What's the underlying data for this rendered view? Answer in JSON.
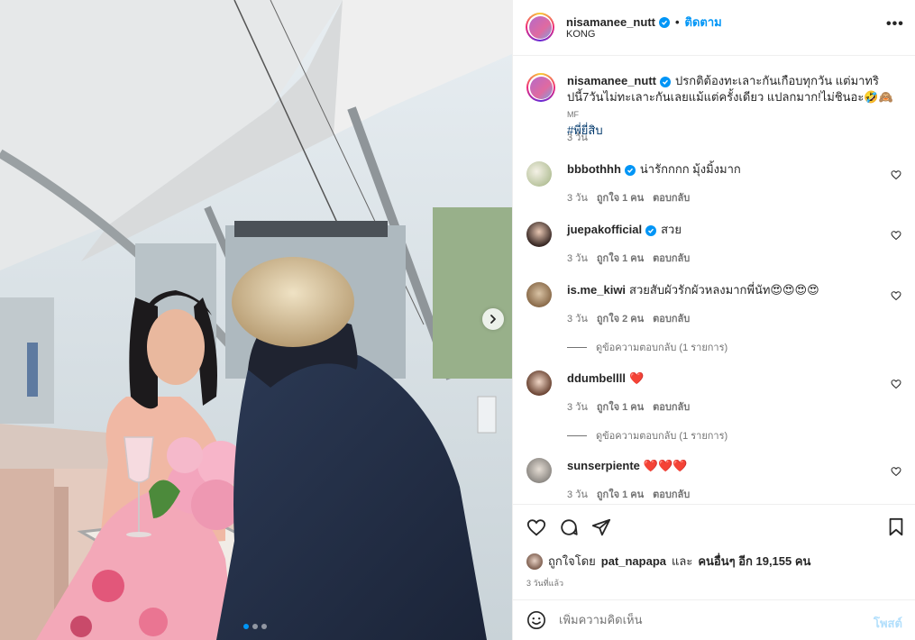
{
  "header": {
    "username": "nisamanee_nutt",
    "separator": "•",
    "follow_label": "ติดตาม",
    "location": "KONG",
    "more_label": "•••"
  },
  "caption": {
    "username": "nisamanee_nutt",
    "text": "ปรกติต้องทะเลาะกันเกือบทุกวัน แต่มาทริปนี้7วันไม่ทะเลาะกันเลยแม้แต่ครั้งเดียว แปลกมาก!ไม่ชินอะ🤣🙈",
    "suffix": "MF",
    "hashtag": "#พี่ยี่สิบ",
    "time": "3 วัน"
  },
  "comments": [
    {
      "username": "bbbothhh",
      "verified": true,
      "text": "น่ารักกกก มุ้งมิ้งมาก",
      "time": "3 วัน",
      "likes": "ถูกใจ 1 คน",
      "reply": "ตอบกลับ"
    },
    {
      "username": "juepakofficial",
      "verified": true,
      "text": "สวย",
      "time": "3 วัน",
      "likes": "ถูกใจ 1 คน",
      "reply": "ตอบกลับ"
    },
    {
      "username": "is.me_kiwi",
      "verified": false,
      "text": "สวยสับผัวรักผัวหลงมากพี่นัท😍😍😍😍",
      "time": "3 วัน",
      "likes": "ถูกใจ 2 คน",
      "reply": "ตอบกลับ",
      "view_replies": "ดูข้อความตอบกลับ (1 รายการ)"
    },
    {
      "username": "ddumbellll",
      "verified": false,
      "text": "❤️",
      "time": "3 วัน",
      "likes": "ถูกใจ 1 คน",
      "reply": "ตอบกลับ",
      "view_replies": "ดูข้อความตอบกลับ (1 รายการ)"
    },
    {
      "username": "sunserpiente",
      "verified": false,
      "text": "❤️❤️❤️",
      "time": "3 วัน",
      "likes": "ถูกใจ 1 คน",
      "reply": "ตอบกลับ"
    }
  ],
  "likes": {
    "prefix": "ถูกใจโดย",
    "liked_by": "pat_napapa",
    "and": "และ",
    "others": "คนอื่นๆ อีก 19,155 คน"
  },
  "post_time": "3 วันที่แล้ว",
  "add_comment": {
    "placeholder": "เพิ่มความคิดเห็น",
    "post_label": "โพสต์"
  },
  "carousel": {
    "slide_count": 3,
    "active_index": 0
  },
  "colors": {
    "accent": "#0095f6",
    "hashtag": "#00376b",
    "muted": "#737373",
    "post_disabled": "#b2dffc"
  }
}
